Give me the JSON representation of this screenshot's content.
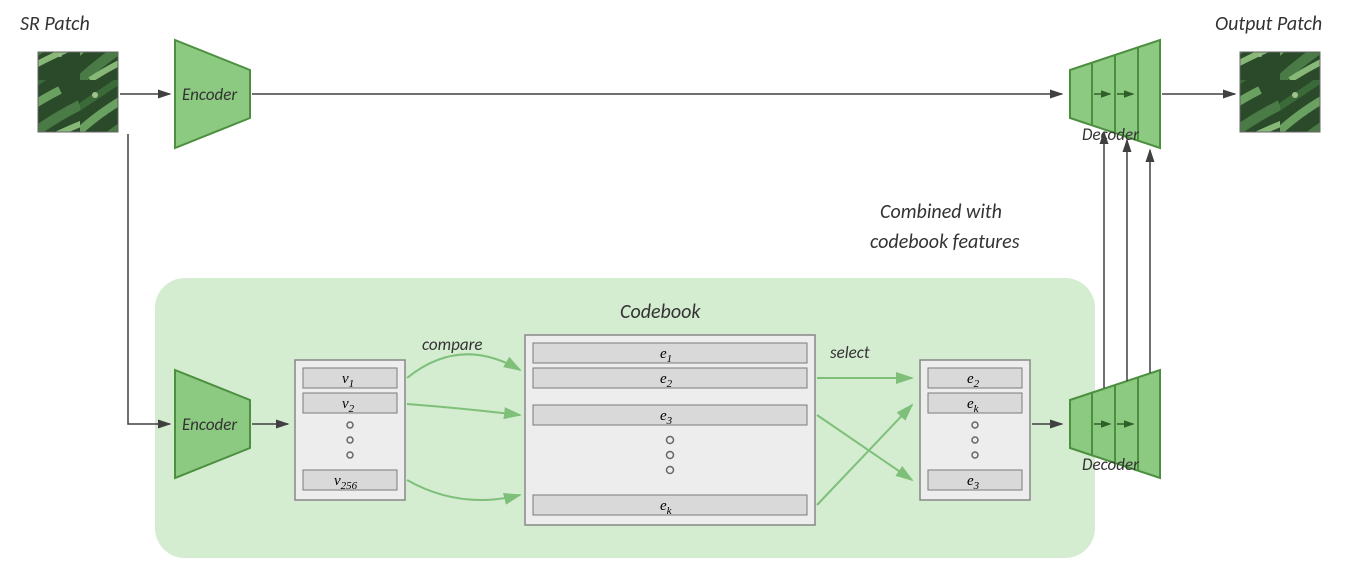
{
  "labels": {
    "sr_patch": "SR Patch",
    "output_patch": "Output Patch",
    "encoder": "Encoder",
    "decoder": "Decoder",
    "codebook": "Codebook",
    "compare": "compare",
    "select": "select",
    "combined_line1": "Combined with",
    "combined_line2": "codebook features"
  },
  "latent_vectors": {
    "v1": "v",
    "v1_sub": "1",
    "v2": "v",
    "v2_sub": "2",
    "v256": "v",
    "v256_sub": "256"
  },
  "codebook_entries": {
    "e1": "e",
    "e1_sub": "1",
    "e2": "e",
    "e2_sub": "2",
    "e3": "e",
    "e3_sub": "3",
    "ek": "e",
    "ek_sub": "k"
  },
  "selected_entries": {
    "s1": "e",
    "s1_sub": "2",
    "s2": "e",
    "s2_sub": "k",
    "s3": "e",
    "s3_sub": "3"
  },
  "colors": {
    "green_fill": "#8cc981",
    "green_dark": "#4b8f3f",
    "panel_fill": "#d4ecd0",
    "box_fill": "#ededed",
    "box_stroke": "#888",
    "slot_fill": "#d9d9d9",
    "slot_stroke": "#7a7a7a",
    "arrow": "#404040",
    "green_arrow": "#7ec07a"
  }
}
